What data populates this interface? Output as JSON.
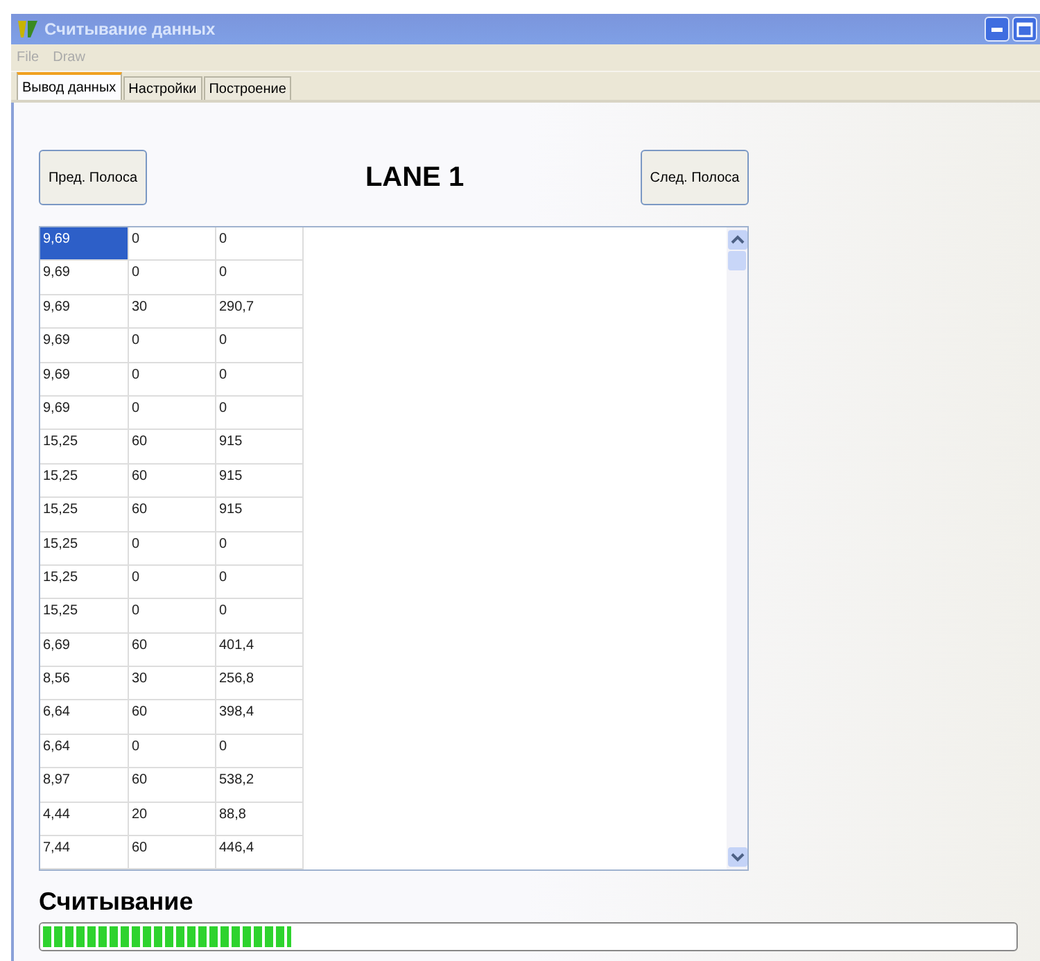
{
  "window": {
    "title": "Считывание данных"
  },
  "menu": [
    "File",
    "Draw"
  ],
  "tabs": [
    {
      "label": "Вывод данных",
      "selected": true
    },
    {
      "label": "Настройки",
      "selected": false
    },
    {
      "label": "Построение",
      "selected": false
    }
  ],
  "prev_button": "Пред. Полоса",
  "lane_title": "LANE 1",
  "next_button": "След. Полоса",
  "rows": [
    {
      "cells": [
        "9,69",
        "0",
        "0"
      ],
      "selected": true
    },
    {
      "cells": [
        "9,69",
        "0",
        "0"
      ],
      "selected": false
    },
    {
      "cells": [
        "9,69",
        "30",
        "290,7"
      ],
      "selected": false
    },
    {
      "cells": [
        "9,69",
        "0",
        "0"
      ],
      "selected": false
    },
    {
      "cells": [
        "9,69",
        "0",
        "0"
      ],
      "selected": false
    },
    {
      "cells": [
        "9,69",
        "0",
        "0"
      ],
      "selected": false
    },
    {
      "cells": [
        "15,25",
        "60",
        "915"
      ],
      "selected": false
    },
    {
      "cells": [
        "15,25",
        "60",
        "915"
      ],
      "selected": false
    },
    {
      "cells": [
        "15,25",
        "60",
        "915"
      ],
      "selected": false
    },
    {
      "cells": [
        "15,25",
        "0",
        "0"
      ],
      "selected": false
    },
    {
      "cells": [
        "15,25",
        "0",
        "0"
      ],
      "selected": false
    },
    {
      "cells": [
        "15,25",
        "0",
        "0"
      ],
      "selected": false
    },
    {
      "cells": [
        "6,69",
        "60",
        "401,4"
      ],
      "selected": false
    },
    {
      "cells": [
        "8,56",
        "30",
        "256,8"
      ],
      "selected": false
    },
    {
      "cells": [
        "6,64",
        "60",
        "398,4"
      ],
      "selected": false
    },
    {
      "cells": [
        "6,64",
        "0",
        "0"
      ],
      "selected": false
    },
    {
      "cells": [
        "8,97",
        "60",
        "538,2"
      ],
      "selected": false
    },
    {
      "cells": [
        "4,44",
        "20",
        "88,8"
      ],
      "selected": false
    },
    {
      "cells": [
        "7,44",
        "60",
        "446,4"
      ],
      "selected": false
    }
  ],
  "progress": {
    "label": "Считывание",
    "level": 0.26
  }
}
